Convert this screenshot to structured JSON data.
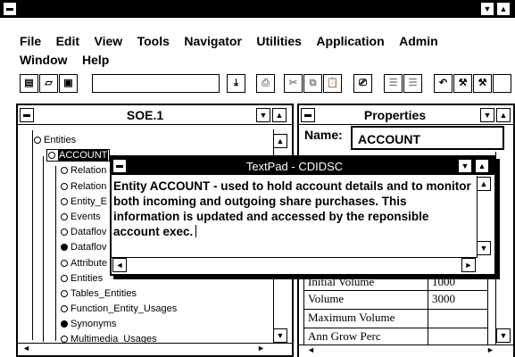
{
  "menu": {
    "row1": [
      "File",
      "Edit",
      "View",
      "Tools",
      "Navigator",
      "Utilities",
      "Application",
      "Admin"
    ],
    "row2": [
      "Window",
      "Help"
    ]
  },
  "left_window": {
    "title": "SOE.1",
    "tree": [
      {
        "label": "Entities",
        "level": 0,
        "filled": false
      },
      {
        "label": "ACCOUNT",
        "level": 1,
        "filled": false,
        "selected": true
      },
      {
        "label": "Relation",
        "level": 2,
        "filled": false
      },
      {
        "label": "Relation",
        "level": 2,
        "filled": false
      },
      {
        "label": "Entity_E",
        "level": 2,
        "filled": false
      },
      {
        "label": "Events",
        "level": 2,
        "filled": false
      },
      {
        "label": "Dataflov",
        "level": 2,
        "filled": false
      },
      {
        "label": "Dataflov",
        "level": 2,
        "filled": true
      },
      {
        "label": "Attribute",
        "level": 2,
        "filled": false
      },
      {
        "label": "Entities",
        "level": 2,
        "filled": false
      },
      {
        "label": "Tables_Entities",
        "level": 2,
        "filled": false
      },
      {
        "label": "Function_Entity_Usages",
        "level": 2,
        "filled": false
      },
      {
        "label": "Synonyms",
        "level": 2,
        "filled": true
      },
      {
        "label": "Multimedia_Usages",
        "level": 2,
        "filled": false
      }
    ]
  },
  "right_window": {
    "title": "Properties",
    "name_label": "Name:",
    "name_value": "ACCOUNT",
    "rows": [
      {
        "label": "Initial Volume",
        "value": "1000"
      },
      {
        "label": "Volume",
        "value": "3000"
      },
      {
        "label": "Maximum Volume",
        "value": ""
      },
      {
        "label": "Ann Grow Perc",
        "value": ""
      }
    ]
  },
  "textpad": {
    "title": "TextPad - CDIDSC",
    "text": "Entity ACCOUNT - used to hold account details and to monitor both incoming and outgoing share purchases. This information is updated and accessed by the reponsible account exec."
  }
}
